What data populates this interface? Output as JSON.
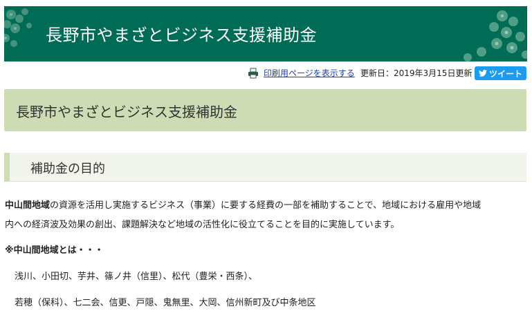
{
  "banner": {
    "title": "長野市やまざとビジネス支援補助金"
  },
  "utility": {
    "print_link": "印刷用ページを表示する",
    "updated": "更新日：2019年3月15日更新",
    "tweet": "ツイート"
  },
  "page": {
    "title": "長野市やまざとビジネス支援補助金"
  },
  "section": {
    "heading": "補助金の目的"
  },
  "body": {
    "bold_term": "中山間地域",
    "line1_rest": "の資源を活用し実施するビジネス（事業）に要する経費の一部を補助することで、地域における雇用や地域",
    "line2": "内への経済波及効果の創出、課題解決など地域の活性化に役立てることを目的に実施しています。",
    "note": "※中山間地域とは・・・",
    "areas_line1": "浅川、小田切、芋井、篠ノ井（信里）、松代（豊栄・西条）、",
    "areas_line2": "若穂（保科）、七二会、信更、戸隠、鬼無里、大岡、信州新町及び中条地区"
  },
  "colors": {
    "banner": "#006c55",
    "title_box": "#cddcb3",
    "link": "#1a3fb0",
    "tweet": "#1d9bf0"
  }
}
